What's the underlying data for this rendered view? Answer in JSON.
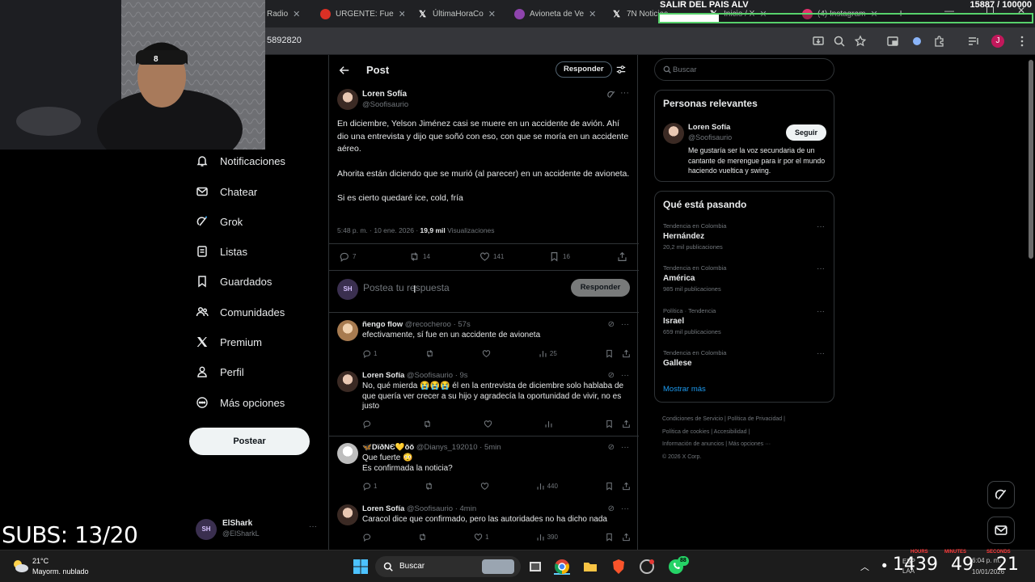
{
  "browser": {
    "tabs": [
      {
        "label": "Radio",
        "color": "#1d9bf0",
        "glyph": ""
      },
      {
        "label": "URGENTE: Fue",
        "color": "#d93025",
        "glyph": ""
      },
      {
        "label": "ÚltimaHoraCo",
        "color": "#000000",
        "glyph": "X"
      },
      {
        "label": "Avioneta de Ve",
        "color": "#8e44ad",
        "glyph": ""
      },
      {
        "label": "7N Noticias",
        "color": "#000000",
        "glyph": "X"
      },
      {
        "label": "Inicio / X",
        "color": "#000000",
        "glyph": "X"
      },
      {
        "label": "(4) Instagram",
        "color": "#e1306c",
        "glyph": ""
      }
    ],
    "url": "5892820"
  },
  "overlay": {
    "goal_text": "SALIR DEL PAIS ALV",
    "goal_count": "15887",
    "goal_target": "/ 100000",
    "goal_progress": 0.159,
    "subs": "SUBS: 13/20"
  },
  "nav": {
    "items": [
      {
        "label": "Notificaciones",
        "icon": "bell-icon"
      },
      {
        "label": "Chatear",
        "icon": "mail-icon"
      },
      {
        "label": "Grok",
        "icon": "grok-icon"
      },
      {
        "label": "Listas",
        "icon": "list-icon"
      },
      {
        "label": "Guardados",
        "icon": "bookmark-icon"
      },
      {
        "label": "Comunidades",
        "icon": "people-icon"
      },
      {
        "label": "Premium",
        "icon": "x-logo-icon"
      },
      {
        "label": "Perfil",
        "icon": "person-icon"
      },
      {
        "label": "Más opciones",
        "icon": "more-circle-icon"
      }
    ],
    "post_button": "Postear",
    "account_name": "ElShark",
    "account_handle": "@ElSharkL"
  },
  "post_header": {
    "title": "Post",
    "reply_button": "Responder"
  },
  "main_post": {
    "name": "Loren Sofía",
    "handle": "@Soofisaurio",
    "paragraphs": [
      "En diciembre, Yelson Jiménez casi se muere en un accidente de avión. Ahí dio una entrevista y dijo que soñó con eso, con que se moría en un accidente aéreo.",
      "Ahorita están diciendo que se murió (al parecer) en un accidente de avioneta.",
      "Si es cierto quedaré ice, cold, fría"
    ],
    "time": "5:48 p. m. · 10 ene. 2026 · ",
    "views_count": "19,9 mil",
    "views_label": " Visualizaciones",
    "replies": "7",
    "reposts": "14",
    "likes": "141",
    "bookmarks": "16"
  },
  "composer": {
    "placeholder": "Postea tu respuesta",
    "button": "Responder"
  },
  "replies": [
    {
      "name": "ñengo flow",
      "handle": "@recocheroo",
      "time": "· 57s",
      "text": "efectivamente, sí fue en un accidente de avioneta",
      "replies": "1",
      "reposts": "",
      "likes": "",
      "views": "25",
      "avatar_color": "#c9a27a"
    },
    {
      "name": "Loren Sofía",
      "handle": "@Soofisaurio",
      "time": "· 9s",
      "text": "No, qué mierda 😭😭😭 él en la entrevista de diciembre solo hablaba de que quería ver crecer a su hijo y agradecía la oportunidad de vivir, no es justo",
      "replies": "",
      "reposts": "",
      "likes": "",
      "views": "",
      "avatar_color": "#6b4b3e"
    },
    {
      "name": "🦋DïðNЄ💛ŏŏ",
      "handle": "@Dianys_192010",
      "time": "· 5min",
      "text": "Que fuerte 😳\nEs confirmada la noticia?",
      "replies": "1",
      "reposts": "",
      "likes": "",
      "views": "440",
      "avatar_color": "#d8d8d8"
    },
    {
      "name": "Loren Sofía",
      "handle": "@Soofisaurio",
      "time": "· 4min",
      "text": "Caracol dice que confirmado, pero las autoridades no ha dicho nada",
      "replies": "",
      "reposts": "",
      "likes": "1",
      "views": "390",
      "avatar_color": "#6b4b3e"
    }
  ],
  "search": {
    "placeholder": "Buscar"
  },
  "relevant": {
    "title": "Personas relevantes",
    "name": "Loren Sofía",
    "handle": "@Soofisaurio",
    "follow": "Seguir",
    "bio": "Me gustaría ser la voz secundaria de un cantante de merengue para ir por el mundo haciendo vueltica y swing."
  },
  "trends": {
    "title": "Qué está pasando",
    "items": [
      {
        "category": "Tendencia en Colombia",
        "name": "Hernández",
        "count": "20,2 mil publicaciones"
      },
      {
        "category": "Tendencia en Colombia",
        "name": "América",
        "count": "985 mil publicaciones"
      },
      {
        "category": "Política · Tendencia",
        "name": "Israel",
        "count": "659 mil publicaciones"
      },
      {
        "category": "Tendencia en Colombia",
        "name": "Gallese",
        "count": ""
      }
    ],
    "show_more": "Mostrar más"
  },
  "footer": {
    "line1": "Condiciones de Servicio  |  Política de Privacidad  |",
    "line2": "Política de cookies  |  Accesibilidad  |",
    "line3": "Información de anuncios  |  Más opciones ···",
    "line4": "© 2026 X Corp."
  },
  "taskbar": {
    "weather_temp": "21°C",
    "weather_desc": "Mayorm. nublado",
    "search": "Buscar",
    "whatsapp_badge": "88",
    "lang": "ESP",
    "lang2": "LAA",
    "clock_time": "6:04 p. m.",
    "clock_date": "10/01/2026",
    "timer_hours_label": "HOURS",
    "timer_minutes_label": "MINUTES",
    "timer_seconds_label": "SECONDS",
    "timer_hours": "1439",
    "timer_minutes": "49",
    "timer_seconds": "21"
  },
  "colors": {
    "accent": "#1d9bf0",
    "bg": "#000000",
    "border": "#2f3336",
    "muted": "#71767b"
  }
}
